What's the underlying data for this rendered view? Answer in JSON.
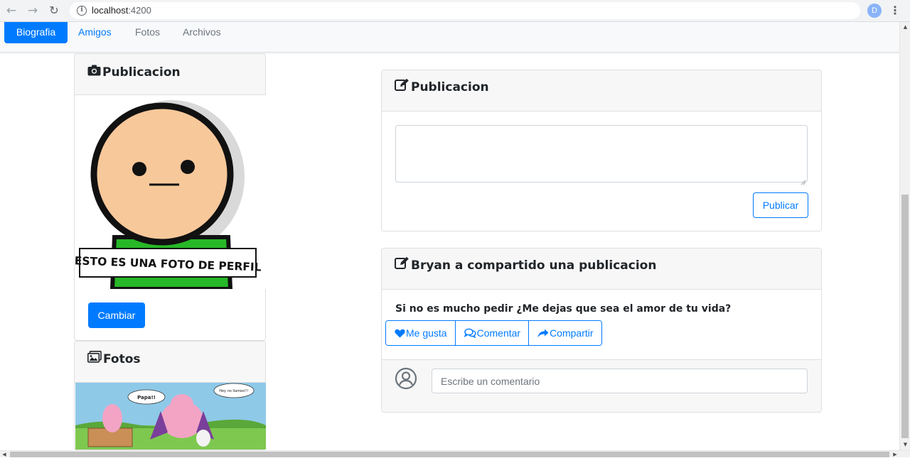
{
  "browser": {
    "url_host": "localhost",
    "url_port": ":4200",
    "profile_initial": "D"
  },
  "nav": {
    "items": [
      {
        "label": "Biografia",
        "active": true
      },
      {
        "label": "Amigos"
      },
      {
        "label": "Fotos"
      },
      {
        "label": "Archivos"
      }
    ]
  },
  "profile_card": {
    "title": "Publicacion",
    "photo_caption": "ESTO ES UNA FOTO DE PERFIL",
    "change_button": "Cambiar"
  },
  "photos_card": {
    "title": "Fotos",
    "bubble_left": "Papa!!",
    "bubble_right": "Hey no llames!!!"
  },
  "publish_card": {
    "title": "Publicacion",
    "textarea_value": "",
    "submit_button": "Publicar"
  },
  "post_card": {
    "title": "Bryan a compartido una publicacion",
    "text": "Si no es mucho pedir ¿Me dejas que sea el amor de tu vida?",
    "like_button": "Me gusta",
    "comment_button": "Comentar",
    "share_button": "Compartir",
    "comment_placeholder": "Escribe un comentario"
  },
  "colors": {
    "primary": "#007bff",
    "header_bg": "#f7f7f7",
    "nav_bg": "#f8f9fa"
  }
}
